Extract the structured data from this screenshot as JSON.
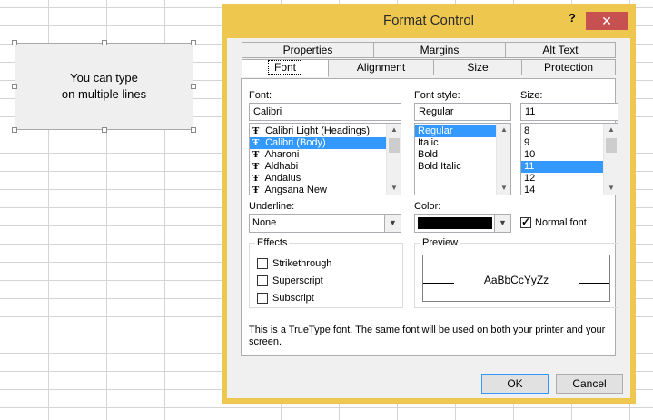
{
  "shape": {
    "line1": "You can type",
    "line2": "on multiple lines"
  },
  "dialog": {
    "title": "Format Control",
    "help": "?",
    "close": "✕",
    "tabs_top": [
      "Properties",
      "Margins",
      "Alt Text"
    ],
    "tabs_bottom": [
      "Font",
      "Alignment",
      "Size",
      "Protection"
    ],
    "font": {
      "label": "Font:",
      "value": "Calibri",
      "items": [
        "Calibri Light (Headings)",
        "Calibri (Body)",
        "Aharoni",
        "Aldhabi",
        "Andalus",
        "Angsana New"
      ],
      "selected_index": 1
    },
    "style": {
      "label": "Font style:",
      "value": "Regular",
      "items": [
        "Regular",
        "Italic",
        "Bold",
        "Bold Italic"
      ],
      "selected_index": 0
    },
    "size": {
      "label": "Size:",
      "value": "11",
      "items": [
        "8",
        "9",
        "10",
        "11",
        "12",
        "14"
      ],
      "selected_index": 3
    },
    "underline": {
      "label": "Underline:",
      "value": "None"
    },
    "color": {
      "label": "Color:",
      "swatch": "#000000"
    },
    "normal_font": {
      "label": "Normal font",
      "checked": true
    },
    "effects": {
      "title": "Effects",
      "strikethrough": "Strikethrough",
      "superscript": "Superscript",
      "subscript": "Subscript"
    },
    "preview": {
      "title": "Preview",
      "sample": "AaBbCcYyZz"
    },
    "description": "This is a TrueType font.  The same font will be used on both your printer and your screen.",
    "ok": "OK",
    "cancel": "Cancel"
  },
  "colors": {
    "titlebar": "#eec84e",
    "close": "#c75050",
    "selection": "#3399ff"
  }
}
